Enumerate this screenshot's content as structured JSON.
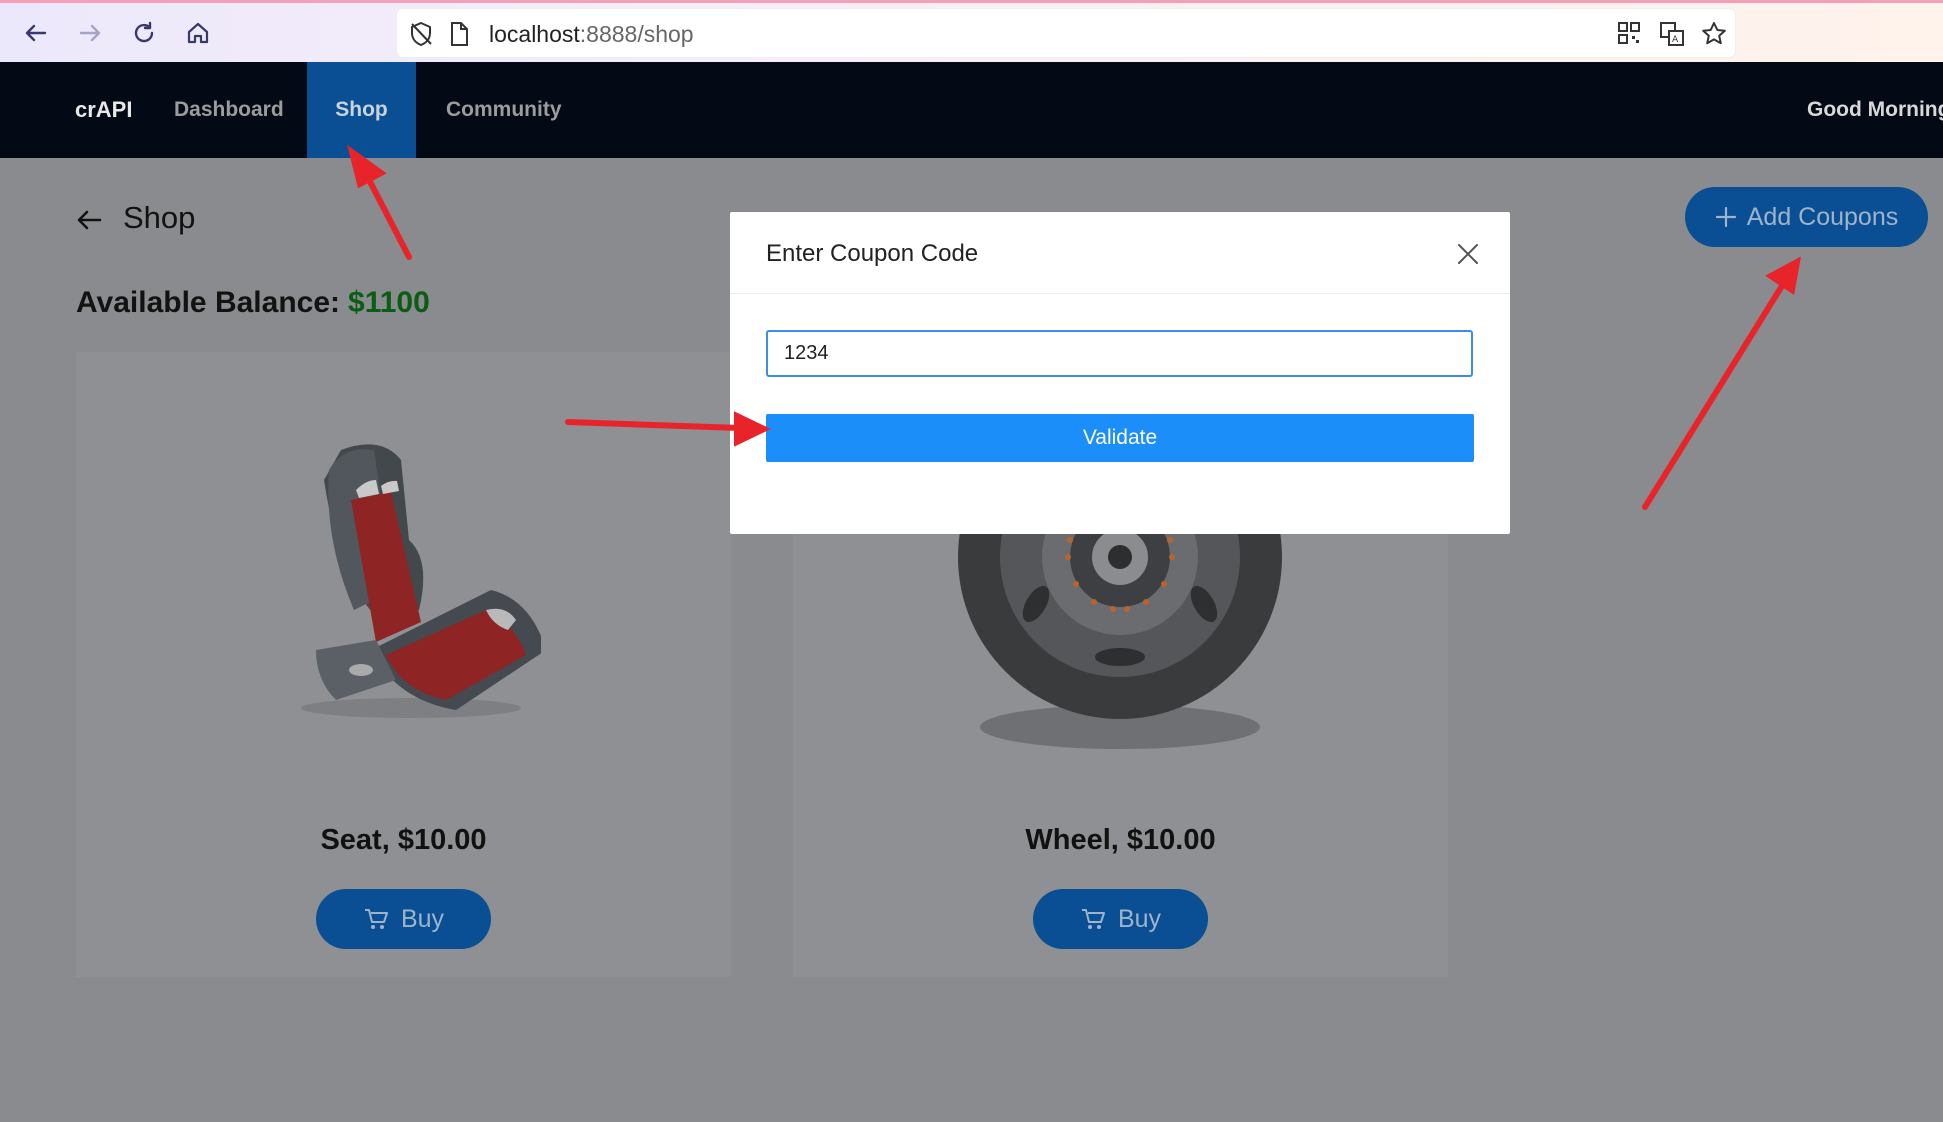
{
  "browser": {
    "url_host": "localhost",
    "url_path": ":8888/shop"
  },
  "nav": {
    "brand": "crAPI",
    "links": [
      {
        "label": "Dashboard"
      },
      {
        "label": "Shop"
      },
      {
        "label": "Community"
      }
    ],
    "greeting": "Good Morning"
  },
  "page": {
    "title": "Shop",
    "balance_label": "Available Balance:",
    "balance_value": "$1100",
    "add_coupons_label": "Add Coupons"
  },
  "products": [
    {
      "name": "Seat, $10.00",
      "buy_label": "Buy"
    },
    {
      "name": "Wheel, $10.00",
      "buy_label": "Buy"
    }
  ],
  "modal": {
    "title": "Enter Coupon Code",
    "input_value": "1234",
    "validate_label": "Validate"
  },
  "colors": {
    "accent": "#1c8ef9",
    "nav_bg": "#030a15",
    "balance": "#0b5d14",
    "annotation": "#e8232a"
  }
}
